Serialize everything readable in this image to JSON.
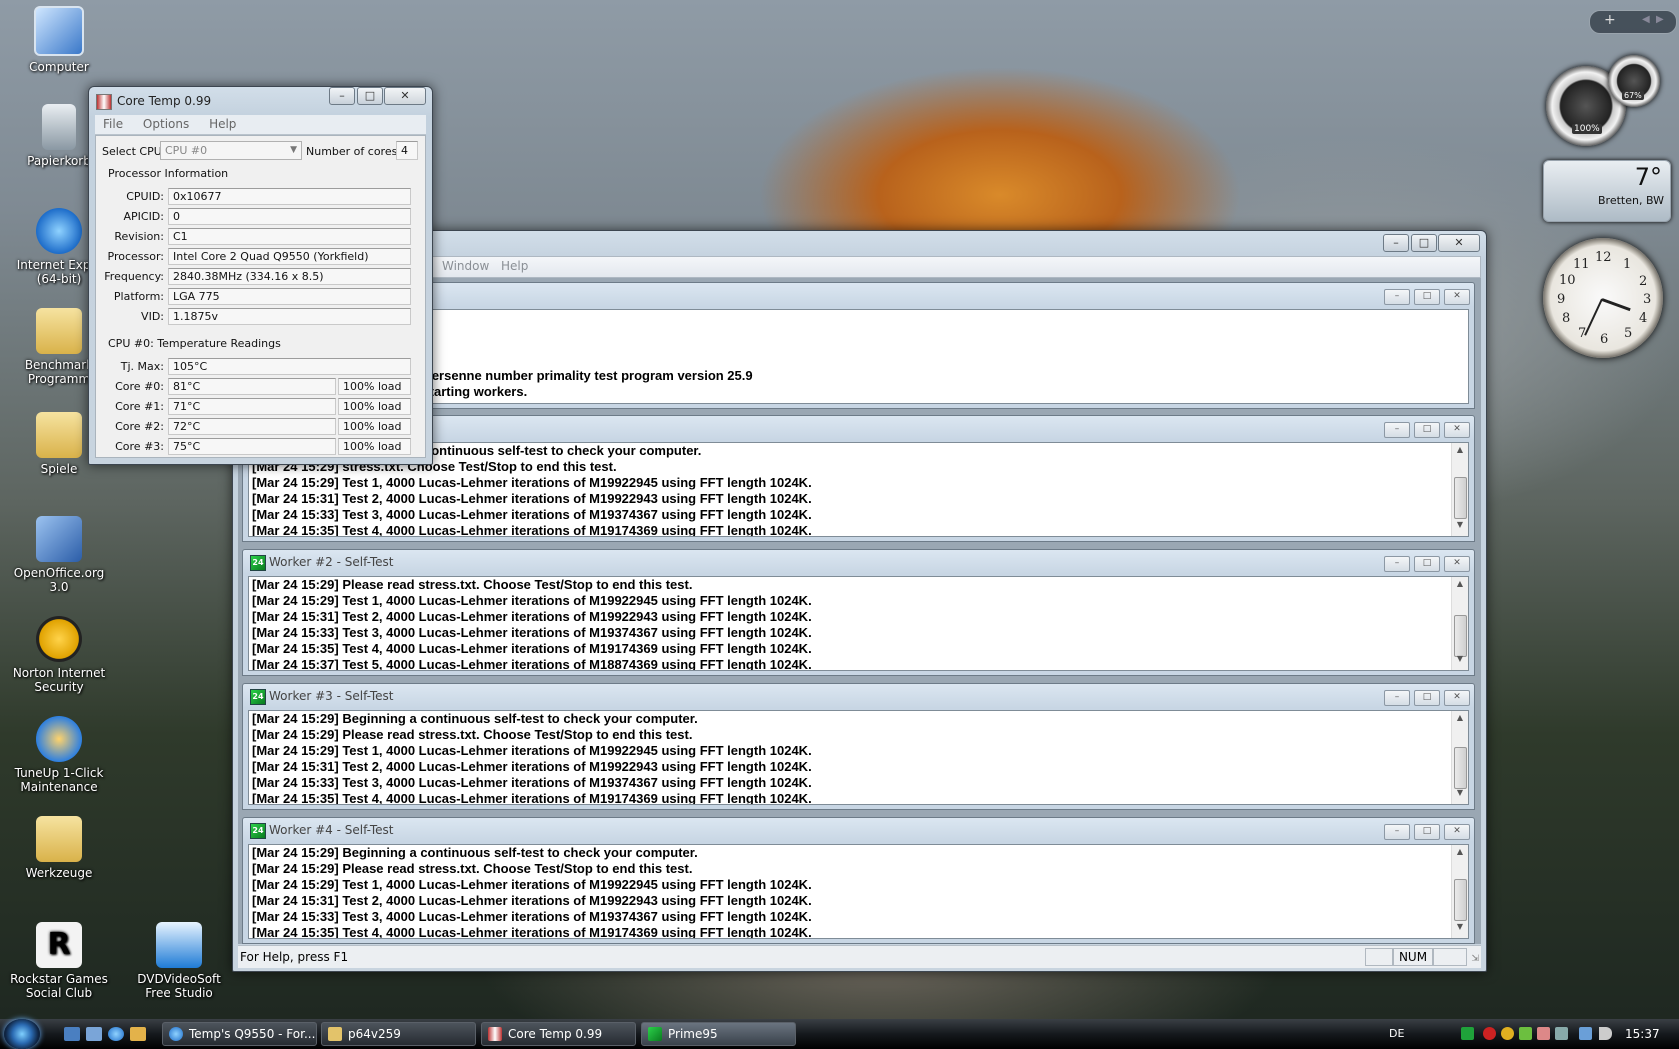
{
  "desktop": {
    "icons": [
      {
        "label": "Computer",
        "icon": "computer-icon"
      },
      {
        "label": "Papierkorb",
        "icon": "recycle-bin-icon"
      },
      {
        "label": "Internet Explo (64-bit)",
        "icon": "internet-explorer-icon"
      },
      {
        "label": "Benchmark Programm",
        "icon": "folder-icon"
      },
      {
        "label": "Spiele",
        "icon": "folder-icon"
      },
      {
        "label": "OpenOffice.org 3.0",
        "icon": "openoffice-icon"
      },
      {
        "label": "Norton Internet Security",
        "icon": "norton-icon"
      },
      {
        "label": "TuneUp 1-Click Maintenance",
        "icon": "tuneup-icon"
      },
      {
        "label": "Werkzeuge",
        "icon": "folder-icon"
      },
      {
        "label": "Rockstar Games Social Club",
        "icon": "rockstar-icon"
      },
      {
        "label": "DVDVideoSoft Free Studio",
        "icon": "dvdvideosoft-icon"
      }
    ]
  },
  "coretemp": {
    "title": "Core Temp 0.99",
    "menu": [
      "File",
      "Options",
      "Help"
    ],
    "select_cpu_label": "Select CPU:",
    "select_cpu_value": "CPU #0",
    "cores_label": "Number of cores",
    "cores_value": "4",
    "proc_group": "Processor Information",
    "proc_rows": [
      {
        "label": "CPUID:",
        "value": "0x10677"
      },
      {
        "label": "APICID:",
        "value": "0"
      },
      {
        "label": "Revision:",
        "value": "C1"
      },
      {
        "label": "Processor:",
        "value": "Intel Core 2 Quad Q9550 (Yorkfield)"
      },
      {
        "label": "Frequency:",
        "value": "2840.38MHz (334.16 x 8.5)"
      },
      {
        "label": "Platform:",
        "value": "LGA 775"
      },
      {
        "label": "VID:",
        "value": "1.1875v"
      }
    ],
    "temp_group": "CPU #0: Temperature Readings",
    "tj_label": "Tj. Max:",
    "tj_value": "105°C",
    "cores": [
      {
        "label": "Core #0:",
        "temp": "81°C",
        "load": "100% load"
      },
      {
        "label": "Core #1:",
        "temp": "71°C",
        "load": "100% load"
      },
      {
        "label": "Core #2:",
        "temp": "72°C",
        "load": "100% load"
      },
      {
        "label": "Core #3:",
        "temp": "75°C",
        "load": "100% load"
      }
    ]
  },
  "prime": {
    "menu": [
      "Window",
      "Help"
    ],
    "main_lines": [
      "Mersenne number primality test program version 25.9",
      "Starting workers."
    ],
    "worker1_lines": [
      "continuous self-test to check your computer.",
      "stress.txt.  Choose Test/Stop to end this test.",
      "[Mar 24 15:29] Test 1, 4000 Lucas-Lehmer iterations of M19922945 using FFT length 1024K.",
      "[Mar 24 15:31] Test 2, 4000 Lucas-Lehmer iterations of M19922943 using FFT length 1024K.",
      "[Mar 24 15:33] Test 3, 4000 Lucas-Lehmer iterations of M19374367 using FFT length 1024K.",
      "[Mar 24 15:35] Test 4, 4000 Lucas-Lehmer iterations of M19174369 using FFT length 1024K."
    ],
    "worker1_prefix": [
      "",
      "[Mar 24 15:29]"
    ],
    "worker2_title": "Worker #2 - Self-Test",
    "worker2_lines": [
      "[Mar 24 15:29] Please read stress.txt.  Choose Test/Stop to end this test.",
      "[Mar 24 15:29] Test 1, 4000 Lucas-Lehmer iterations of M19922945 using FFT length 1024K.",
      "[Mar 24 15:31] Test 2, 4000 Lucas-Lehmer iterations of M19922943 using FFT length 1024K.",
      "[Mar 24 15:33] Test 3, 4000 Lucas-Lehmer iterations of M19374367 using FFT length 1024K.",
      "[Mar 24 15:35] Test 4, 4000 Lucas-Lehmer iterations of M19174369 using FFT length 1024K.",
      "[Mar 24 15:37] Test 5, 4000 Lucas-Lehmer iterations of M18874369 using FFT length 1024K."
    ],
    "worker3_title": "Worker #3 - Self-Test",
    "worker3_lines": [
      "[Mar 24 15:29] Beginning a continuous self-test to check your computer.",
      "[Mar 24 15:29] Please read stress.txt.  Choose Test/Stop to end this test.",
      "[Mar 24 15:29] Test 1, 4000 Lucas-Lehmer iterations of M19922945 using FFT length 1024K.",
      "[Mar 24 15:31] Test 2, 4000 Lucas-Lehmer iterations of M19922943 using FFT length 1024K.",
      "[Mar 24 15:33] Test 3, 4000 Lucas-Lehmer iterations of M19374367 using FFT length 1024K.",
      "[Mar 24 15:35] Test 4, 4000 Lucas-Lehmer iterations of M19174369 using FFT length 1024K."
    ],
    "worker4_title": "Worker #4 - Self-Test",
    "worker4_lines": [
      "[Mar 24 15:29] Beginning a continuous self-test to check your computer.",
      "[Mar 24 15:29] Please read stress.txt.  Choose Test/Stop to end this test.",
      "[Mar 24 15:29] Test 1, 4000 Lucas-Lehmer iterations of M19922945 using FFT length 1024K.",
      "[Mar 24 15:31] Test 2, 4000 Lucas-Lehmer iterations of M19922943 using FFT length 1024K.",
      "[Mar 24 15:33] Test 3, 4000 Lucas-Lehmer iterations of M19374367 using FFT length 1024K.",
      "[Mar 24 15:35] Test 4, 4000 Lucas-Lehmer iterations of M19174369 using FFT length 1024K."
    ],
    "status_text": "For Help, press F1",
    "status_num": "NUM"
  },
  "gadgets": {
    "cpu_gauge_value": "100%",
    "mem_gauge_value": "67%",
    "weather_temp": "7°",
    "weather_location": "Bretten, BW",
    "clock_numbers": [
      "12",
      "1",
      "2",
      "3",
      "4",
      "5",
      "6",
      "7",
      "8",
      "9",
      "10",
      "11"
    ],
    "sidebar_add": "+"
  },
  "taskbar": {
    "buttons": [
      {
        "label": "Temp's Q9550 - For...",
        "icon": "internet-explorer-icon"
      },
      {
        "label": "p64v259",
        "icon": "folder-icon"
      },
      {
        "label": "Core Temp 0.99",
        "icon": "coretemp-icon"
      },
      {
        "label": "Prime95",
        "icon": "prime95-icon"
      }
    ],
    "lang": "DE",
    "time": "15:37"
  },
  "colors": {
    "accent": "#2b6bb3",
    "log_text": "#000000",
    "mdi_background": "#9aa7b3"
  }
}
